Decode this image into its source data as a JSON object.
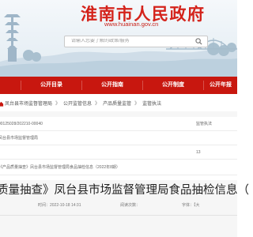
{
  "header": {
    "site_title": "淮南市人民政府",
    "site_url": "www.huainan.gov.cn",
    "search_placeholder": "请输入您要了解的政策/服务"
  },
  "nav": {
    "items": [
      "",
      "公开目录",
      "公开指南",
      "公开制度",
      "公开年报"
    ]
  },
  "breadcrumb": {
    "items": [
      "凤台县市场监督管理局",
      "》",
      "公开监管信息",
      "》",
      "产品质量监管",
      "》",
      "监管执法"
    ]
  },
  "meta": {
    "index_number": "00125028/202210-00040",
    "category_value": "监管执法",
    "publisher": "凤台县市场监督管理局",
    "issue_number": "13",
    "title_full": "《产品质量抽查》凤台县市场监督管理局食品抽检信息（2022年8期）"
  },
  "article": {
    "title": "质量抽查》凤台县市场监督管理局食品抽检信息（",
    "publish_time": "时间：2022-10-18 14:31",
    "view_count": "阅读次数：",
    "font_label": "字体：【大",
    "date_label": "2022-10-18"
  },
  "colors": {
    "brand_red": "#c8170f",
    "title_red": "#d4231b"
  }
}
